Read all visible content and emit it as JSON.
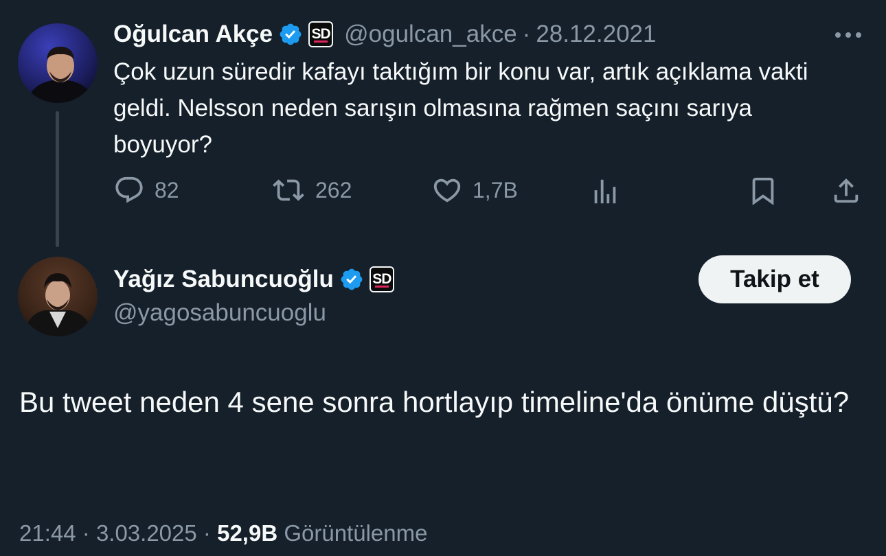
{
  "quoted_tweet": {
    "author_name": "Oğulcan Akçe",
    "handle": "@ogulcan_akce",
    "separator": "·",
    "date": "28.12.2021",
    "text": "Çok uzun süredir kafayı taktığım bir konu var, artık açıklama vakti geldi. Nelsson neden sarışın olmasına rağmen saçını sarıya boyuyor?",
    "org_badge": "SD",
    "actions": {
      "replies": "82",
      "retweets": "262",
      "likes": "1,7B"
    }
  },
  "main_tweet": {
    "author_name": "Yağız Sabuncuoğlu",
    "handle": "@yagosabuncuoglu",
    "org_badge": "SD",
    "follow_label": "Takip et",
    "text": "Bu tweet neden 4 sene sonra hortlayıp timeline'da önüme düştü?",
    "time": "21:44",
    "separator": "·",
    "date": "3.03.2025",
    "views_count": "52,9B",
    "views_label": "Görüntülenme"
  },
  "colors": {
    "background": "#15202b",
    "text_primary": "#f7f9f9",
    "text_muted": "#8b98a5",
    "verified_blue": "#1d9bf0",
    "button_bg": "#eff3f4"
  },
  "icons": [
    "verified-icon",
    "sd-badge",
    "more-icon",
    "reply-icon",
    "retweet-icon",
    "like-icon",
    "views-icon",
    "bookmark-icon",
    "share-icon"
  ]
}
